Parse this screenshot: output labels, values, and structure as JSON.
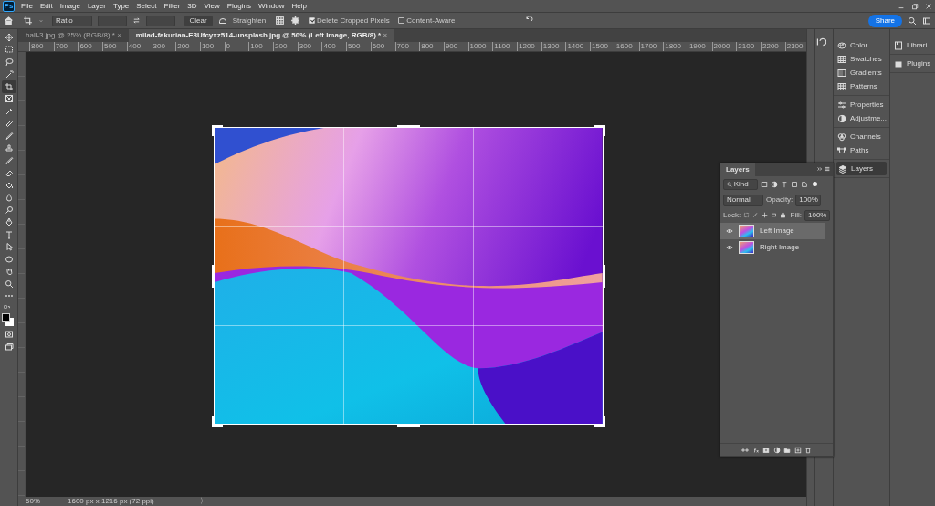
{
  "app_badge": "Ps",
  "menu": [
    "File",
    "Edit",
    "Image",
    "Layer",
    "Type",
    "Select",
    "Filter",
    "3D",
    "View",
    "Plugins",
    "Window",
    "Help"
  ],
  "options_bar": {
    "ratio": "Ratio",
    "clear": "Clear",
    "straighten": "Straighten",
    "checkboxes": [
      {
        "label": "Delete Cropped Pixels",
        "checked": true
      },
      {
        "label": "Content-Aware",
        "checked": false
      }
    ],
    "share": "Share"
  },
  "tabs": [
    {
      "label": "ball-3.jpg @ 25% (RGB/8) *",
      "close": "×",
      "selected": false
    },
    {
      "label": "milad-fakurian-E8Ufcyxz514-unsplash.jpg @ 50% (Left Image, RGB/8) *",
      "close": "×",
      "selected": true
    }
  ],
  "ruler_labels": [
    "800",
    "700",
    "600",
    "500",
    "400",
    "300",
    "200",
    "100",
    "0",
    "100",
    "200",
    "300",
    "400",
    "500",
    "600",
    "700",
    "800",
    "900",
    "1000",
    "1100",
    "1200",
    "1300",
    "1400",
    "1500",
    "1600",
    "1700",
    "1800",
    "1900",
    "2000",
    "2100",
    "2200",
    "2300"
  ],
  "tools": [
    {
      "kind": "move",
      "selected": false
    },
    {
      "kind": "marquee",
      "selected": false
    },
    {
      "kind": "lasso",
      "selected": false
    },
    {
      "kind": "wand",
      "selected": false
    },
    {
      "kind": "crop",
      "selected": true
    },
    {
      "kind": "frame",
      "selected": false
    },
    {
      "kind": "eyedropper",
      "selected": false
    },
    {
      "kind": "bandage",
      "selected": false
    },
    {
      "kind": "brush",
      "selected": false
    },
    {
      "kind": "stamp",
      "selected": false
    },
    {
      "kind": "brush",
      "selected": false
    },
    {
      "kind": "eraser",
      "selected": false
    },
    {
      "kind": "bucket",
      "selected": false
    },
    {
      "kind": "drop",
      "selected": false
    },
    {
      "kind": "dodge",
      "selected": false
    },
    {
      "kind": "pen",
      "selected": false
    },
    {
      "kind": "type",
      "selected": false
    },
    {
      "kind": "arrow",
      "selected": false
    },
    {
      "kind": "ellipse",
      "selected": false
    },
    {
      "kind": "hand",
      "selected": false
    },
    {
      "kind": "zoom",
      "selected": false
    },
    {
      "kind": "more",
      "selected": false
    }
  ],
  "panel_column_1": [
    {
      "group": [
        {
          "kind": "color",
          "label": "Color"
        },
        {
          "kind": "grid",
          "label": "Swatches"
        },
        {
          "kind": "gradient",
          "label": "Gradients"
        },
        {
          "kind": "grid",
          "label": "Patterns"
        }
      ]
    },
    {
      "group": [
        {
          "kind": "sliders",
          "label": "Properties"
        },
        {
          "kind": "half",
          "label": "Adjustme..."
        }
      ]
    },
    {
      "group": [
        {
          "kind": "circles",
          "label": "Channels"
        },
        {
          "kind": "path",
          "label": "Paths"
        }
      ]
    },
    {
      "group": [
        {
          "kind": "layers",
          "label": "Layers",
          "selected": true
        }
      ]
    }
  ],
  "panel_column_2": [
    {
      "kind": "book",
      "label": "Librari..."
    },
    {
      "kind": "plug",
      "label": "Plugins"
    }
  ],
  "layers_panel": {
    "title": "Layers",
    "filter": "Kind",
    "blend_mode": "Normal",
    "opacity_label": "Opacity:",
    "opacity": "100%",
    "lock_label": "Lock:",
    "fill_label": "Fill:",
    "fill": "100%",
    "layers": [
      {
        "name": "Left Image",
        "selected": true,
        "visible": true
      },
      {
        "name": "Right Image",
        "selected": false,
        "visible": true
      }
    ]
  },
  "status_bar": {
    "zoom": "50%",
    "doc_info": "1600 px x 1216 px (72 ppi)",
    "arrow": "〉"
  }
}
